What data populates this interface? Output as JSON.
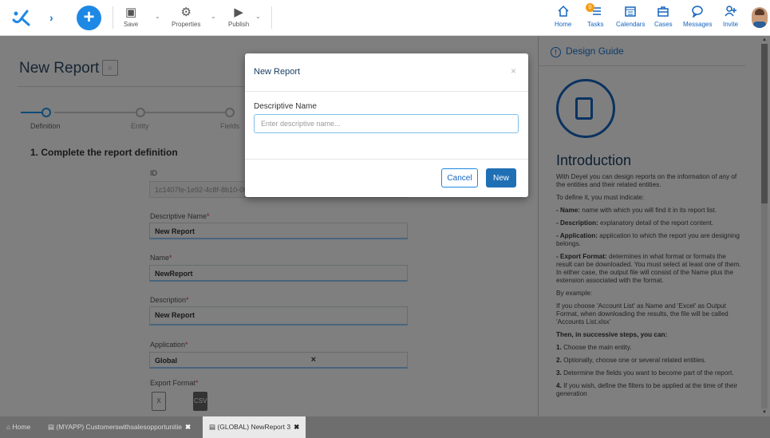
{
  "toolbar": {
    "save_label": "Save",
    "properties_label": "Properties",
    "publish_label": "Publish"
  },
  "right_nav": {
    "home": "Home",
    "tasks": "Tasks",
    "tasks_badge": "0",
    "calendars": "Calendars",
    "cases": "Cases",
    "messages": "Messages",
    "invite": "Invite"
  },
  "page": {
    "title": "New Report",
    "steps": [
      "Definition",
      "Entity",
      "Fields"
    ],
    "section_title": "1. Complete the report definition",
    "fields": {
      "id_label": "ID",
      "id_value": "1c1407fe-1e92-4c8f-8b10-00",
      "descriptive_name_label": "Descriptive Name",
      "descriptive_name_value": "New Report",
      "name_label": "Name",
      "name_value": "NewReport",
      "description_label": "Description",
      "description_value": "New Report",
      "application_label": "Application",
      "application_value": "Global",
      "export_format_label": "Export Format",
      "required_mark": "*"
    }
  },
  "modal": {
    "title": "New Report",
    "close": "×",
    "field_label": "Descriptive Name",
    "field_placeholder": "Enter descriptive name...",
    "field_value": "",
    "cancel_label": "Cancel",
    "new_label": "New"
  },
  "guide": {
    "header": "Design Guide",
    "title": "Introduction",
    "intro": "With Deyel you can design reports on the information of any of the entities and their related entities.",
    "to_define": "To define it, you must indicate:",
    "name_term": "- Name:",
    "name_text": " name with which you will find it in its report list.",
    "desc_term": "- Description:",
    "desc_text": " explanatory detail of the report content.",
    "app_term": "- Application:",
    "app_text": " application to which the report you are designing belongs.",
    "export_term": "- Export Format:",
    "export_text": " determines in what format or formats the result can be downloaded. You must select at least one of them. In either case, the output file will consist of the Name plus the extension associated with the format.",
    "by_example": "By example:",
    "example_text": "If you choose 'Account List' as Name and 'Excel' as Output Format, when downloading the results, the file will be called 'Accounts List.xlsx'",
    "then": "Then, in successive steps, you can:",
    "step1_num": "1.",
    "step1": " Choose the main entity.",
    "step2_num": "2.",
    "step2": " Optionally, choose one or several related entities.",
    "step3_num": "3.",
    "step3": " Determine the fields you want to become part of the report.",
    "step4_num": "4.",
    "step4": " If you wish, define the filters to be applied at the time of their generation"
  },
  "bottom_tabs": {
    "home": "Home",
    "tab1": "(MYAPP) Customerswithsalesopportunitie",
    "tab2": "(GLOBAL) NewReport 3",
    "close": "✖"
  },
  "file_formats": [
    "X",
    "CSV"
  ]
}
